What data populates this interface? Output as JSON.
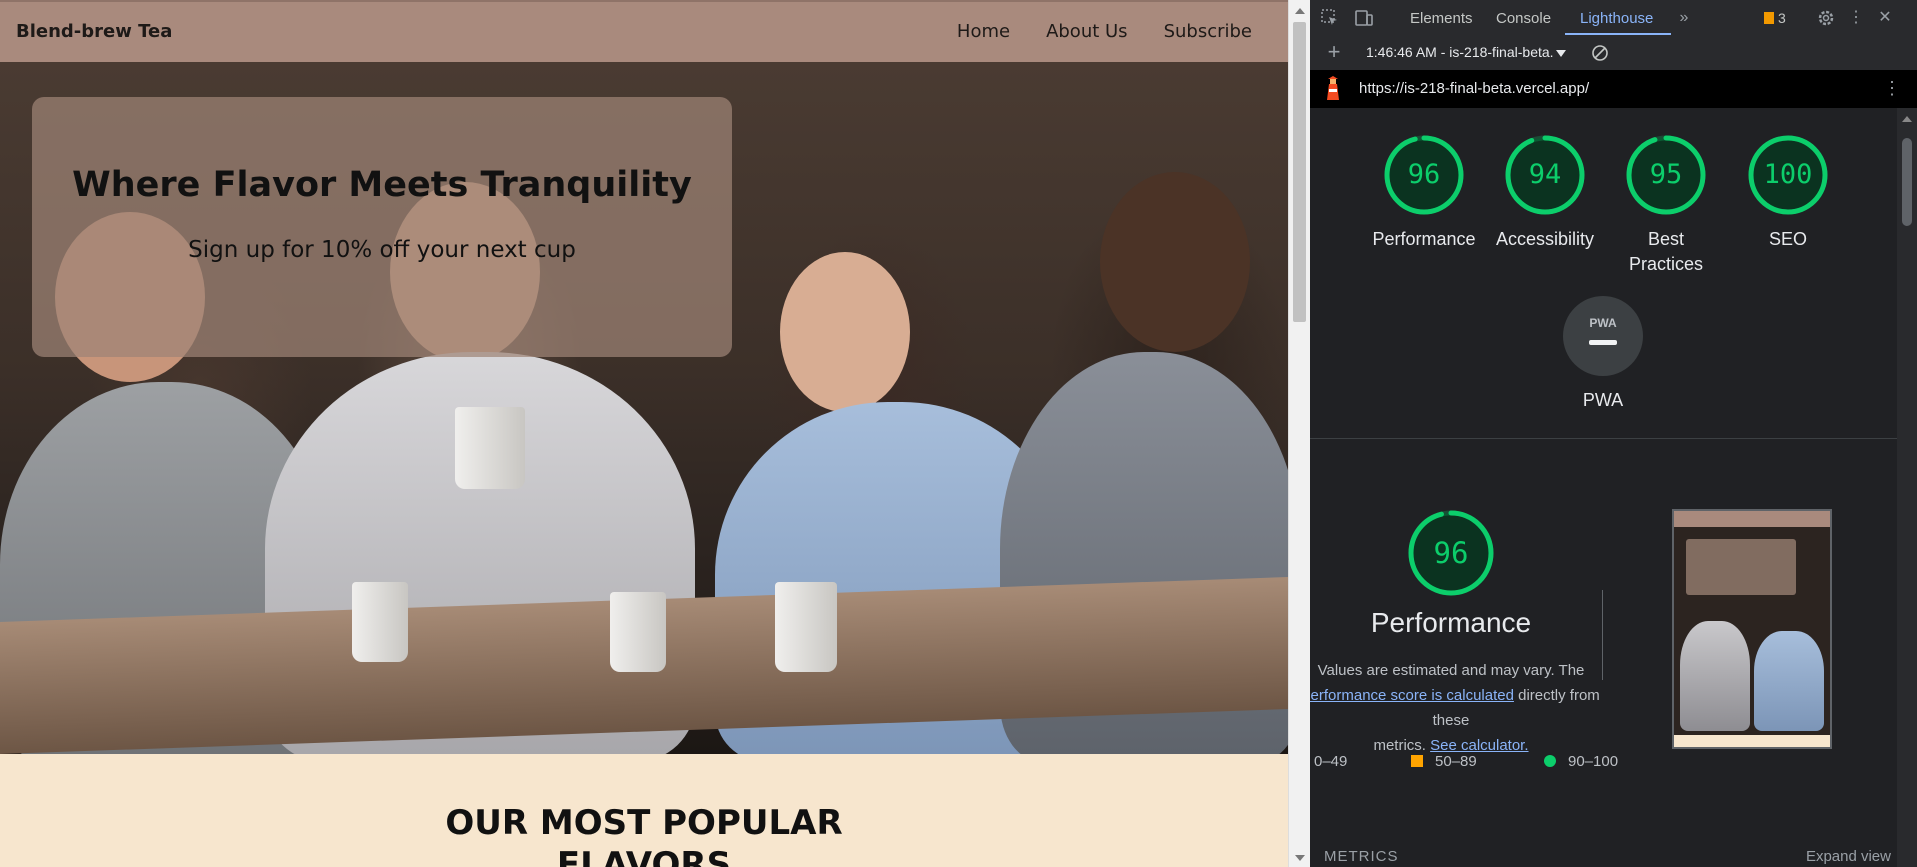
{
  "site": {
    "brand": "Blend-brew Tea",
    "nav": [
      "Home",
      "About Us",
      "Subscribe"
    ],
    "hero_title": "Where Flavor Meets Tranquility",
    "hero_subtitle": "Sign up for 10% off your next cup",
    "section_title_line1": "OUR MOST POPULAR",
    "section_title_line2": "FLAVORS"
  },
  "devtools": {
    "tabs": [
      "Elements",
      "Console",
      "Lighthouse"
    ],
    "active_tab": "Lighthouse",
    "issues_count": "3",
    "report_select": "1:46:46 AM - is-218-final-beta.",
    "url": "https://is-218-final-beta.vercel.app/",
    "categories": [
      {
        "label": "Performance",
        "score": 96
      },
      {
        "label": "Accessibility",
        "score": 94
      },
      {
        "label": "Best Practices",
        "score": 95
      },
      {
        "label": "SEO",
        "score": 100
      }
    ],
    "pwa_label": "PWA",
    "pwa_badge_text": "PWA",
    "perf_score": "96",
    "perf_title": "Performance",
    "perf_desc_1": "Values are estimated and may vary. The",
    "perf_link_1": "performance score is calculated",
    "perf_desc_2": "directly from these",
    "perf_desc_3": "metrics.",
    "perf_link_2": "See calculator.",
    "legend": [
      "0–49",
      "50–89",
      "90–100"
    ],
    "metrics_label": "METRICS",
    "expand_label": "Expand view",
    "colors": {
      "pass": "#0cce6b",
      "average": "#ffa400",
      "link": "#8ab4f8"
    }
  }
}
